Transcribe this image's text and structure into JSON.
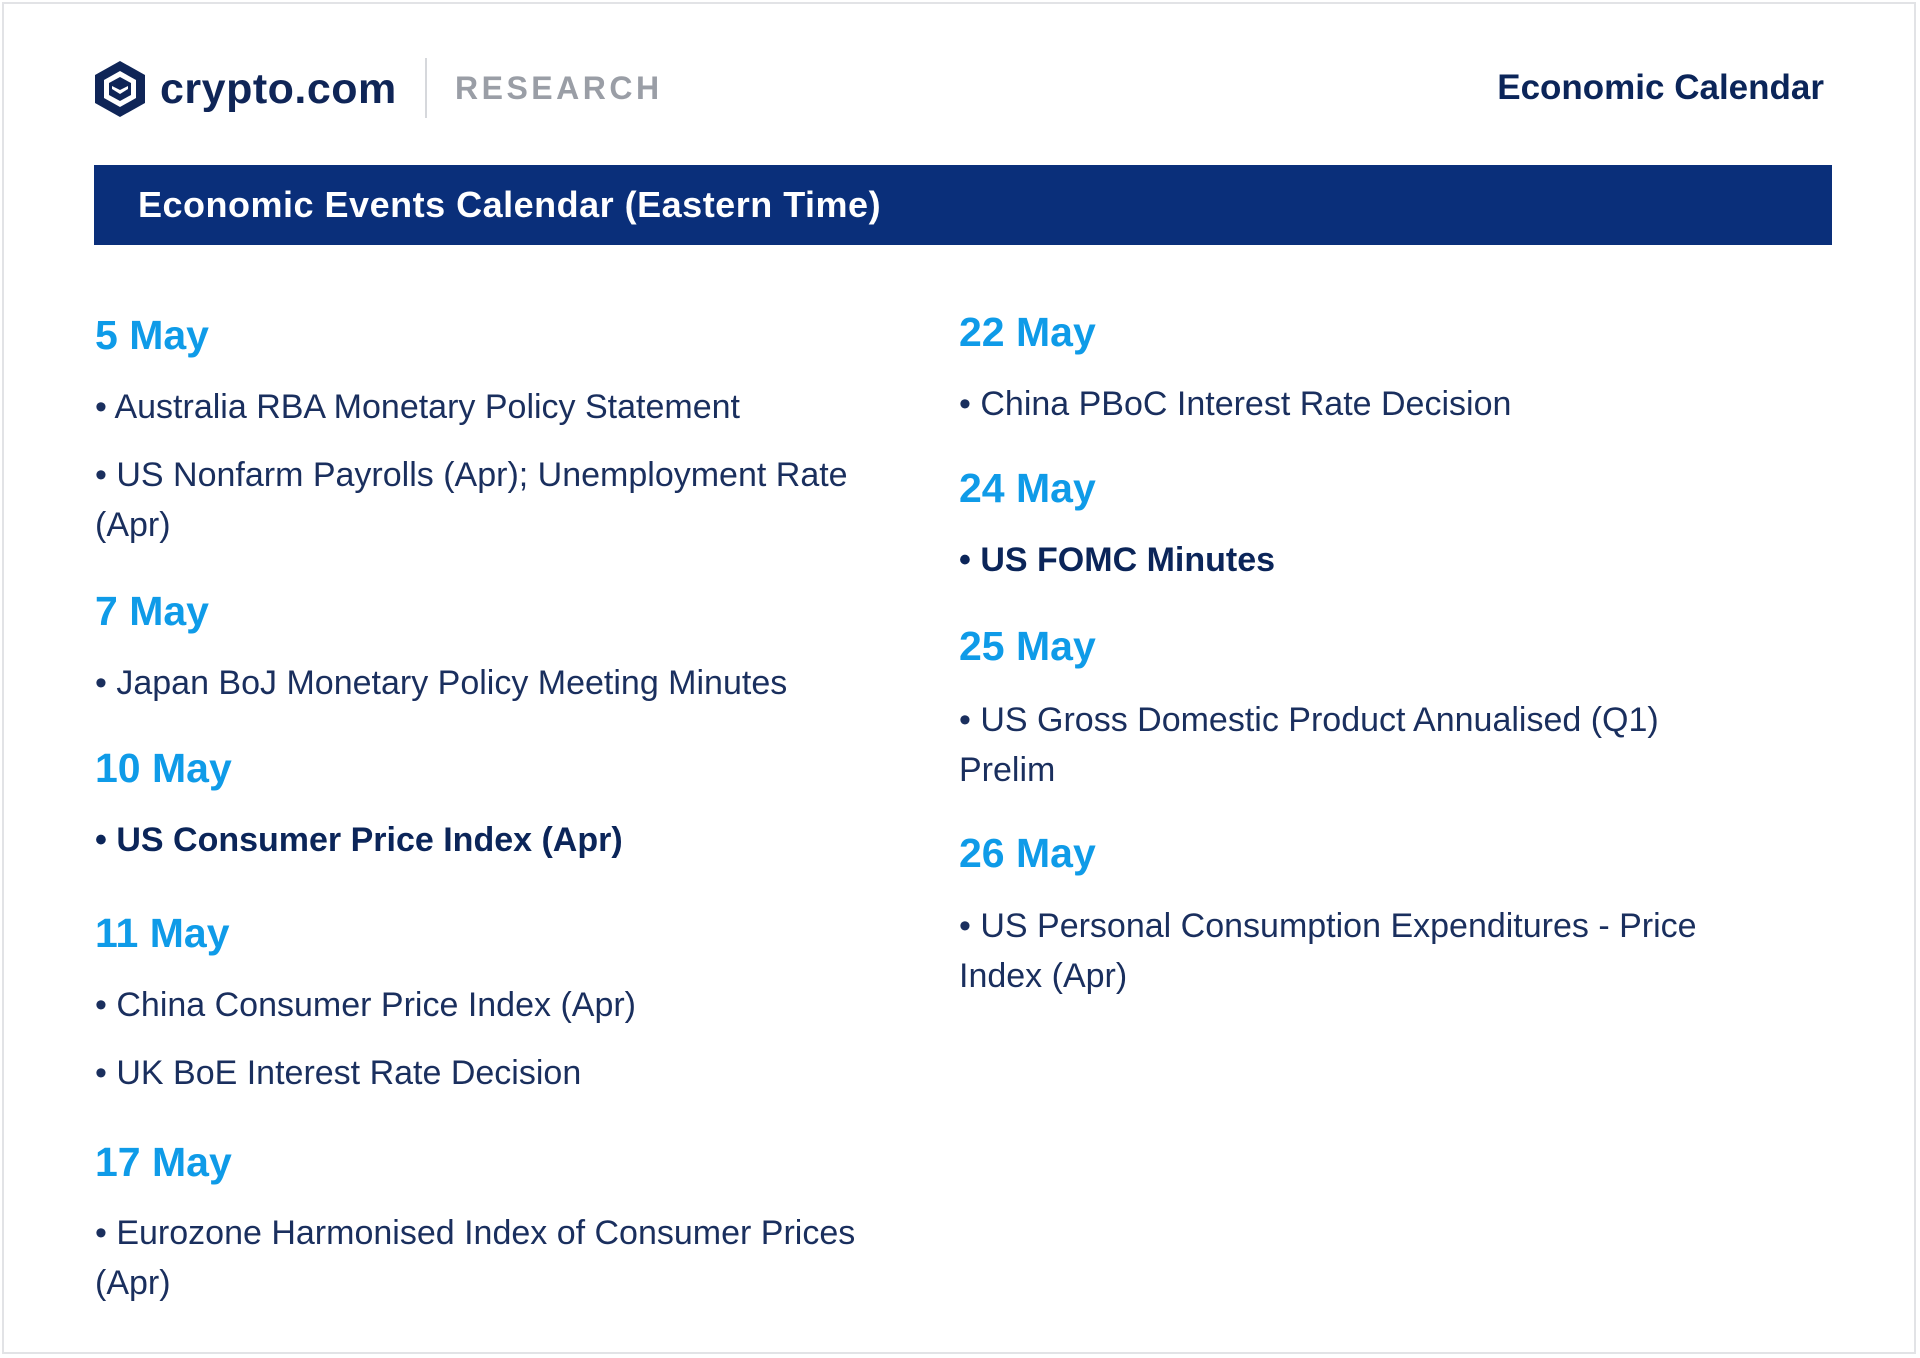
{
  "header": {
    "brand": "crypto.com",
    "section": "RESEARCH",
    "title": "Economic Calendar"
  },
  "banner": {
    "title": "Economic Events Calendar (Eastern Time)"
  },
  "colors": {
    "navy": "#0a2f7a",
    "date_blue": "#0f9be8",
    "text": "#1a2f5e"
  },
  "calendar": {
    "left": [
      {
        "date": "5 May",
        "events": [
          {
            "text": "• Australia RBA Monetary Policy Statement",
            "bold": false
          },
          {
            "text": "• US Nonfarm Payrolls (Apr); Unemployment Rate (Apr)",
            "bold": false
          }
        ]
      },
      {
        "date": "7 May",
        "events": [
          {
            "text": "• Japan BoJ Monetary Policy Meeting Minutes",
            "bold": false
          }
        ]
      },
      {
        "date": "10 May",
        "events": [
          {
            "text": "• US Consumer Price Index (Apr)",
            "bold": true
          }
        ]
      },
      {
        "date": "11 May",
        "events": [
          {
            "text": "• China Consumer Price Index (Apr)",
            "bold": false
          },
          {
            "text": "• UK BoE Interest Rate Decision",
            "bold": false
          }
        ]
      },
      {
        "date": "17 May",
        "events": [
          {
            "text": "• Eurozone Harmonised Index of Consumer Prices (Apr)",
            "bold": false
          }
        ]
      }
    ],
    "right": [
      {
        "date": "22 May",
        "events": [
          {
            "text": "• China PBoC Interest Rate Decision",
            "bold": false
          }
        ]
      },
      {
        "date": "24 May",
        "events": [
          {
            "text": "• US FOMC Minutes",
            "bold": true
          }
        ]
      },
      {
        "date": "25 May",
        "events": [
          {
            "text": "• US Gross Domestic Product Annualised (Q1) Prelim",
            "bold": false
          }
        ]
      },
      {
        "date": "26 May",
        "events": [
          {
            "text": "• US Personal Consumption Expenditures - Price Index (Apr)",
            "bold": false
          }
        ]
      }
    ]
  }
}
